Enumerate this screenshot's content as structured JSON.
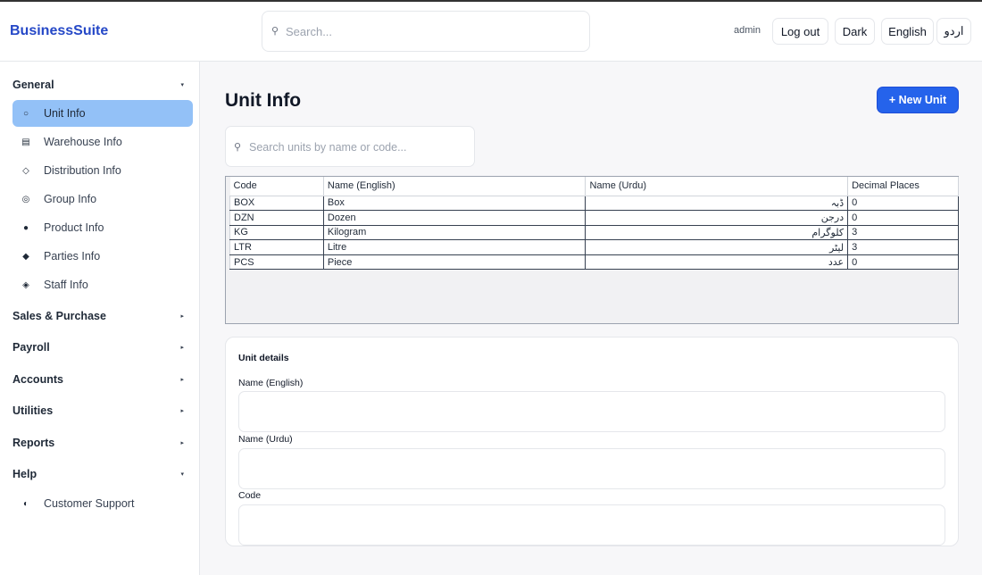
{
  "header": {
    "brand": "BusinessSuite",
    "search_placeholder": "Search...",
    "user": "admin",
    "logout_label": "Log out",
    "theme_label": "Dark",
    "lang_en_label": "English",
    "lang_ur_label": "اردو"
  },
  "sidebar": {
    "groups": [
      {
        "label": "General",
        "caret": "▾"
      },
      {
        "label": "Sales & Purchase",
        "caret": "▸"
      },
      {
        "label": "Payroll",
        "caret": "▸"
      },
      {
        "label": "Accounts",
        "caret": "▸"
      },
      {
        "label": "Utilities",
        "caret": "▸"
      },
      {
        "label": "Reports",
        "caret": "▸"
      },
      {
        "label": "Help",
        "caret": "▾"
      }
    ],
    "general_items": [
      {
        "label": "Unit Info",
        "icon": "○",
        "icon_name": "circle-icon"
      },
      {
        "label": "Warehouse Info",
        "icon": "▤",
        "icon_name": "warehouse-icon"
      },
      {
        "label": "Distribution Info",
        "icon": "◇",
        "icon_name": "diamond-outline-icon"
      },
      {
        "label": "Group Info",
        "icon": "◎",
        "icon_name": "target-icon"
      },
      {
        "label": "Product Info",
        "icon": "●",
        "icon_name": "dot-icon"
      },
      {
        "label": "Parties Info",
        "icon": "◆",
        "icon_name": "diamond-icon"
      },
      {
        "label": "Staff Info",
        "icon": "◈",
        "icon_name": "diamond-dot-icon"
      }
    ],
    "help_items": [
      {
        "label": "Customer Support",
        "icon": "◐",
        "icon_name": "half-circle-icon"
      }
    ]
  },
  "main": {
    "title": "Unit Info",
    "new_button_label": "+ New Unit",
    "search_placeholder": "Search units by name or code...",
    "table": {
      "columns": [
        "Code",
        "Name (English)",
        "Name (Urdu)",
        "Decimal Places"
      ],
      "rows": [
        [
          "BOX",
          "Box",
          "ڈبہ",
          "0"
        ],
        [
          "DZN",
          "Dozen",
          "درجن",
          "0"
        ],
        [
          "KG",
          "Kilogram",
          "کلوگرام",
          "3"
        ],
        [
          "LTR",
          "Litre",
          "لیٹر",
          "3"
        ],
        [
          "PCS",
          "Piece",
          "عدد",
          "0"
        ]
      ]
    },
    "details": {
      "title": "Unit details",
      "name_en_label": "Name (English)",
      "name_ur_label": "Name (Urdu)",
      "code_label": "Code"
    }
  }
}
